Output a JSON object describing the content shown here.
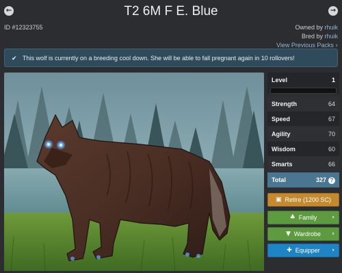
{
  "header": {
    "title": "T2 6M F E. Blue",
    "id_label": "ID #12323755",
    "prev_icon": "circle-arrow-left-icon",
    "next_icon": "circle-arrow-right-icon"
  },
  "ownership": {
    "owned_prefix": "Owned by",
    "owned_user": "rhuik",
    "bred_prefix": "Bred by",
    "bred_user": "rhuik",
    "view_packs": "View Previous Packs"
  },
  "notice": {
    "icon": "check-icon",
    "text": "This wolf is currently on a breeding cool down. She will be able to fall pregnant again in 10 rollovers!"
  },
  "stats": {
    "level_label": "Level",
    "level_value": "1",
    "level_progress": 0,
    "strength_label": "Strength",
    "strength_value": "64",
    "speed_label": "Speed",
    "speed_value": "67",
    "agility_label": "Agility",
    "agility_value": "70",
    "wisdom_label": "Wisdom",
    "wisdom_value": "60",
    "smarts_label": "Smarts",
    "smarts_value": "66",
    "total_label": "Total",
    "total_value": "327"
  },
  "actions": {
    "retire_label": "Retire (1200 SC)",
    "family_label": "Family",
    "wardrobe_label": "Wardrobe",
    "equipper_label": "Equipper"
  },
  "colors": {
    "background": "#2b2d30",
    "notice_bg": "#2f4a5a",
    "total_bg": "#4b7691",
    "retire": "#c58a2f",
    "family": "#5e9a3f",
    "equipper": "#1f84c4",
    "eye_glow": "#5fb0ff"
  }
}
